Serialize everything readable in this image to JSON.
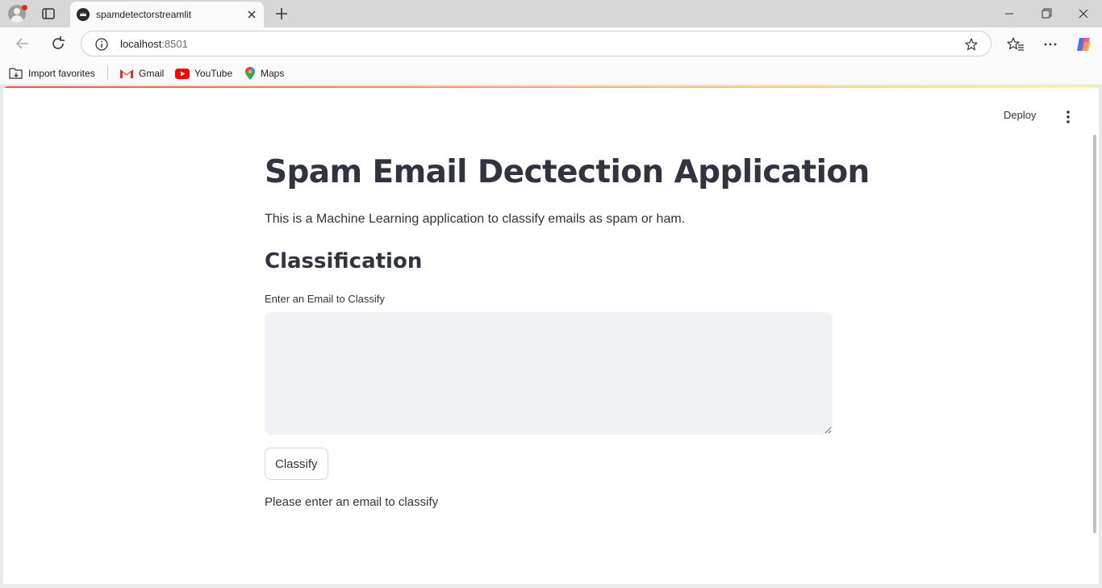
{
  "browser": {
    "tab": {
      "title": "spamdetectorstreamlit"
    },
    "address": {
      "host": "localhost",
      "port": ":8501"
    },
    "bookmarks": [
      {
        "label": "Import favorites",
        "icon": "import-icon"
      },
      {
        "label": "Gmail",
        "icon": "gmail-icon"
      },
      {
        "label": "YouTube",
        "icon": "youtube-icon"
      },
      {
        "label": "Maps",
        "icon": "maps-icon"
      }
    ]
  },
  "app": {
    "header": {
      "deploy_label": "Deploy"
    },
    "title": "Spam Email Dectection Application",
    "subtitle": "This is a Machine Learning application to classify emails as spam or ham.",
    "section_heading": "Classification",
    "email_input": {
      "label": "Enter an Email to Classify",
      "value": ""
    },
    "classify_button": "Classify",
    "result_message": "Please enter an email to classify"
  },
  "colors": {
    "text": "#31333f",
    "input_bg": "#f0f2f6",
    "accent_red": "#ff4b4b"
  }
}
